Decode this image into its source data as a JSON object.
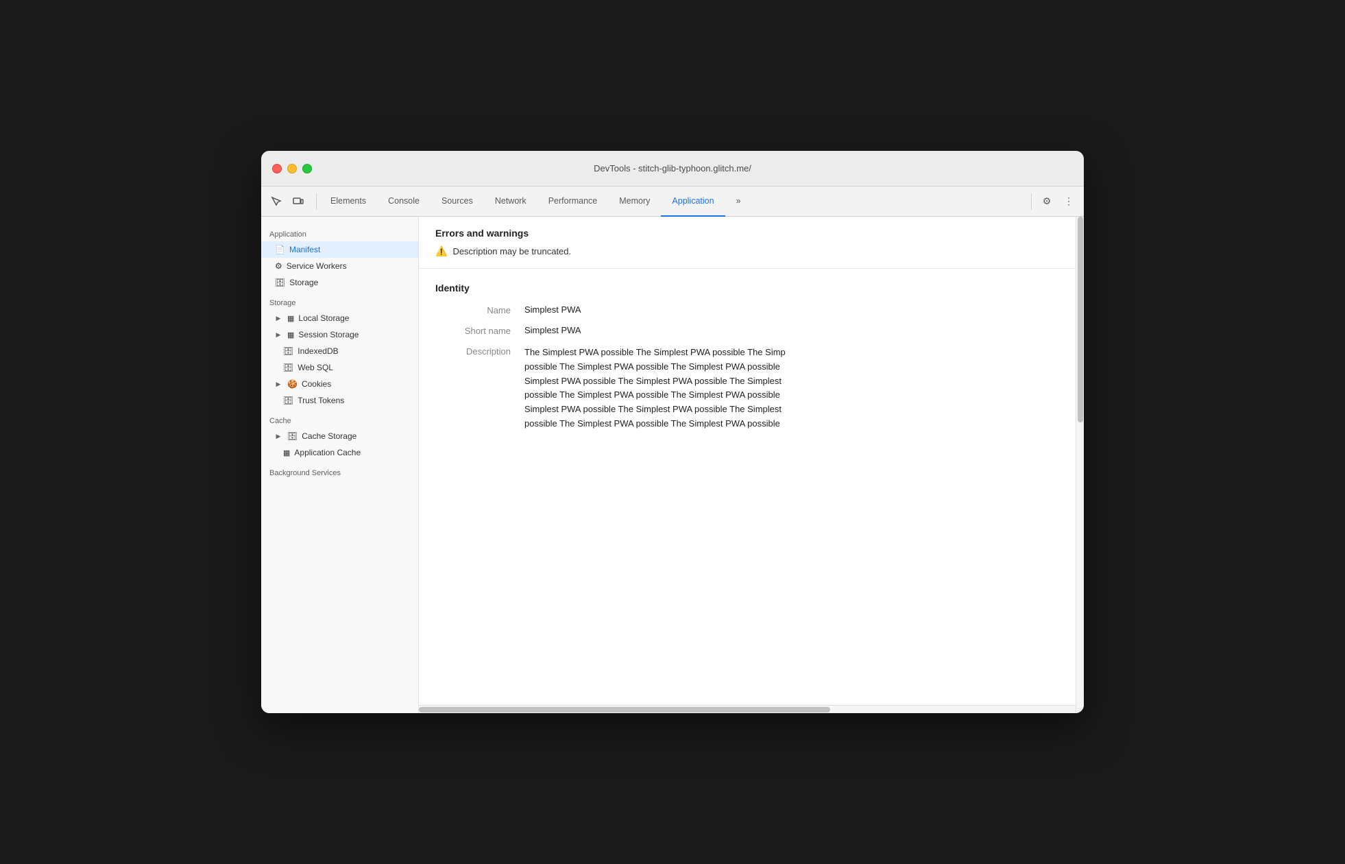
{
  "window": {
    "title": "DevTools - stitch-glib-typhoon.glitch.me/"
  },
  "toolbar": {
    "tabs": [
      {
        "id": "elements",
        "label": "Elements",
        "active": false
      },
      {
        "id": "console",
        "label": "Console",
        "active": false
      },
      {
        "id": "sources",
        "label": "Sources",
        "active": false
      },
      {
        "id": "network",
        "label": "Network",
        "active": false
      },
      {
        "id": "performance",
        "label": "Performance",
        "active": false
      },
      {
        "id": "memory",
        "label": "Memory",
        "active": false
      },
      {
        "id": "application",
        "label": "Application",
        "active": true
      }
    ],
    "more_label": "»",
    "settings_icon": "⚙",
    "more_icon": "⋮"
  },
  "sidebar": {
    "application_section": "Application",
    "application_items": [
      {
        "id": "manifest",
        "label": "Manifest",
        "icon": "📄",
        "active": true,
        "indent": 1
      },
      {
        "id": "service-workers",
        "label": "Service Workers",
        "icon": "⚙",
        "active": false,
        "indent": 1
      },
      {
        "id": "storage",
        "label": "Storage",
        "icon": "🗄",
        "active": false,
        "indent": 1
      }
    ],
    "storage_section": "Storage",
    "storage_items": [
      {
        "id": "local-storage",
        "label": "Local Storage",
        "icon": "▦",
        "active": false,
        "indent": 1,
        "expand": true
      },
      {
        "id": "session-storage",
        "label": "Session Storage",
        "icon": "▦",
        "active": false,
        "indent": 1,
        "expand": true
      },
      {
        "id": "indexeddb",
        "label": "IndexedDB",
        "icon": "🗄",
        "active": false,
        "indent": 1,
        "expand": false
      },
      {
        "id": "web-sql",
        "label": "Web SQL",
        "icon": "🗄",
        "active": false,
        "indent": 1,
        "expand": false
      },
      {
        "id": "cookies",
        "label": "Cookies",
        "icon": "🍪",
        "active": false,
        "indent": 1,
        "expand": true
      },
      {
        "id": "trust-tokens",
        "label": "Trust Tokens",
        "icon": "🗄",
        "active": false,
        "indent": 1,
        "expand": false
      }
    ],
    "cache_section": "Cache",
    "cache_items": [
      {
        "id": "cache-storage",
        "label": "Cache Storage",
        "icon": "🗄",
        "active": false,
        "indent": 1,
        "expand": true
      },
      {
        "id": "application-cache",
        "label": "Application Cache",
        "icon": "▦",
        "active": false,
        "indent": 1,
        "expand": false
      }
    ],
    "background_section": "Background Services"
  },
  "content": {
    "errors_section": {
      "title": "Errors and warnings",
      "warning_text": "Description may be truncated."
    },
    "identity_section": {
      "title": "Identity",
      "fields": [
        {
          "label": "Name",
          "value": "Simplest PWA"
        },
        {
          "label": "Short name",
          "value": "Simplest PWA"
        },
        {
          "label": "Description",
          "value": "The Simplest PWA possible The Simplest PWA possible The Simp\npossible The Simplest PWA possible The Simplest PWA possible \nSimplest PWA possible The Simplest PWA possible The Simplest\npossible The Simplest PWA possible The Simplest PWA possible \nSimplest PWA possible The Simplest PWA possible The Simplest\npossible The Simplest PWA possible The Simplest PWA possible"
        }
      ]
    }
  }
}
